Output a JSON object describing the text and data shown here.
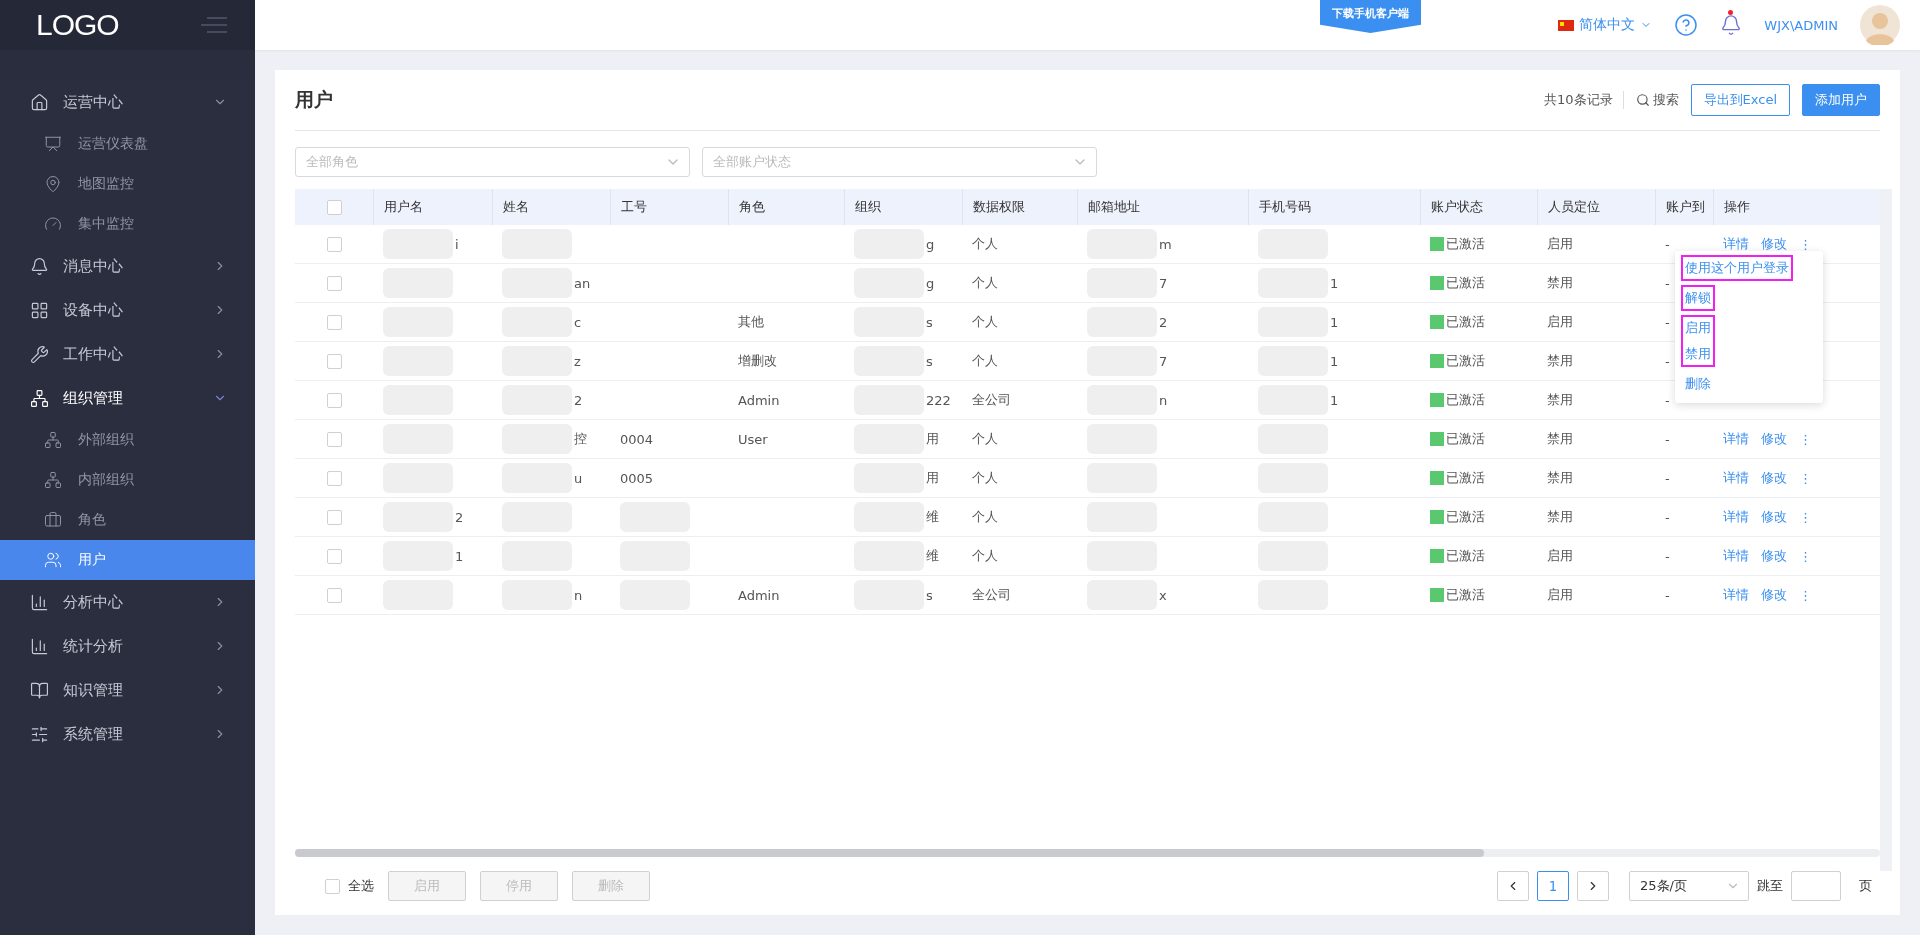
{
  "sidebar": {
    "logo": "LOGO",
    "items": [
      {
        "label": "运营中心",
        "expanded": true,
        "children": [
          {
            "label": "运营仪表盘",
            "selected": false
          },
          {
            "label": "地图监控",
            "selected": false
          },
          {
            "label": "集中监控",
            "selected": false
          }
        ]
      },
      {
        "label": "消息中心",
        "expanded": false
      },
      {
        "label": "设备中心",
        "expanded": false
      },
      {
        "label": "工作中心",
        "expanded": false
      },
      {
        "label": "组织管理",
        "expanded": true,
        "children": [
          {
            "label": "外部组织",
            "selected": false
          },
          {
            "label": "内部组织",
            "selected": false
          },
          {
            "label": "角色",
            "selected": false
          },
          {
            "label": "用户",
            "selected": true
          }
        ]
      },
      {
        "label": "分析中心",
        "expanded": false
      },
      {
        "label": "统计分析",
        "expanded": false
      },
      {
        "label": "知识管理",
        "expanded": false
      },
      {
        "label": "系统管理",
        "expanded": false
      }
    ]
  },
  "header": {
    "download_banner": "下载手机客户端",
    "language": "简体中文",
    "username": "WJX\\ADMIN",
    "has_notification": true
  },
  "page": {
    "title": "用户",
    "record_count": "共10条记录",
    "search": "搜索",
    "export_button": "导出到Excel",
    "add_button": "添加用户",
    "filters": [
      {
        "placeholder": "全部角色"
      },
      {
        "placeholder": "全部账户状态"
      }
    ]
  },
  "table": {
    "columns": [
      "用户名",
      "姓名",
      "工号",
      "角色",
      "组织",
      "数据权限",
      "邮箱地址",
      "手机号码",
      "账户状态",
      "人员定位",
      "账户到",
      "操作"
    ],
    "select_all_checked": false,
    "rows": [
      {
        "checked": false,
        "cells": [
          {
            "text": "i",
            "blurred": true
          },
          {
            "text": "",
            "blurred": true
          },
          {
            "text": ""
          },
          {
            "text": ""
          },
          {
            "text": "g",
            "blurred": true
          },
          {
            "text": "个人"
          },
          {
            "text": "m",
            "blurred": true
          },
          {
            "text": "",
            "blurred": true
          }
        ],
        "status": "已激活",
        "location": "启用",
        "expiry": "-",
        "actions": [
          "详情",
          "修改"
        ],
        "more": "⋮"
      },
      {
        "checked": false,
        "cells": [
          {
            "text": "",
            "blurred": true
          },
          {
            "text": "an",
            "blurred": true
          },
          {
            "text": ""
          },
          {
            "text": ""
          },
          {
            "text": "g",
            "blurred": true
          },
          {
            "text": "个人"
          },
          {
            "text": "7",
            "blurred": true
          },
          {
            "text": "1",
            "blurred": true
          }
        ],
        "status": "已激活",
        "location": "禁用",
        "expiry": "-"
      },
      {
        "checked": false,
        "cells": [
          {
            "text": "",
            "blurred": true
          },
          {
            "text": "c",
            "blurred": true
          },
          {
            "text": ""
          },
          {
            "text": "其他"
          },
          {
            "text": "s",
            "blurred": true
          },
          {
            "text": "个人"
          },
          {
            "text": "2",
            "blurred": true
          },
          {
            "text": "1",
            "blurred": true
          }
        ],
        "status": "已激活",
        "location": "启用",
        "expiry": "-"
      },
      {
        "checked": false,
        "cells": [
          {
            "text": "",
            "blurred": true
          },
          {
            "text": "z",
            "blurred": true
          },
          {
            "text": ""
          },
          {
            "text": "增删改"
          },
          {
            "text": "s",
            "blurred": true
          },
          {
            "text": "个人"
          },
          {
            "text": "7",
            "blurred": true
          },
          {
            "text": "1",
            "blurred": true
          }
        ],
        "status": "已激活",
        "location": "禁用",
        "expiry": "-"
      },
      {
        "checked": false,
        "cells": [
          {
            "text": "",
            "blurred": true
          },
          {
            "text": "2",
            "blurred": true
          },
          {
            "text": ""
          },
          {
            "text": "Admin"
          },
          {
            "text": "222",
            "blurred": true
          },
          {
            "text": "全公司"
          },
          {
            "text": "n",
            "blurred": true
          },
          {
            "text": "1",
            "blurred": true
          }
        ],
        "status": "已激活",
        "location": "禁用",
        "expiry": "-"
      },
      {
        "checked": false,
        "cells": [
          {
            "text": "",
            "blurred": true
          },
          {
            "text": "控",
            "blurred": true
          },
          {
            "text": "0004"
          },
          {
            "text": "User"
          },
          {
            "text": "用",
            "blurred": true
          },
          {
            "text": "个人"
          },
          {
            "text": "",
            "blurred": true
          },
          {
            "text": "",
            "blurred": true
          }
        ],
        "status": "已激活",
        "location": "禁用",
        "expiry": "-",
        "actions": [
          "详情",
          "修改"
        ],
        "more": "⋮"
      },
      {
        "checked": false,
        "cells": [
          {
            "text": "",
            "blurred": true
          },
          {
            "text": "u",
            "blurred": true
          },
          {
            "text": "0005"
          },
          {
            "text": ""
          },
          {
            "text": "用",
            "blurred": true
          },
          {
            "text": "个人"
          },
          {
            "text": "",
            "blurred": true
          },
          {
            "text": "",
            "blurred": true
          }
        ],
        "status": "已激活",
        "location": "禁用",
        "expiry": "-",
        "actions": [
          "详情",
          "修改"
        ],
        "more": "⋮"
      },
      {
        "checked": false,
        "cells": [
          {
            "text": "2",
            "blurred": true
          },
          {
            "text": "",
            "blurred": true
          },
          {
            "text": "",
            "blurred": true
          },
          {
            "text": ""
          },
          {
            "text": "维",
            "blurred": true
          },
          {
            "text": "个人"
          },
          {
            "text": "",
            "blurred": true
          },
          {
            "text": "",
            "blurred": true
          }
        ],
        "status": "已激活",
        "location": "禁用",
        "expiry": "-",
        "actions": [
          "详情",
          "修改"
        ],
        "more": "⋮"
      },
      {
        "checked": false,
        "cells": [
          {
            "text": "1",
            "blurred": true
          },
          {
            "text": "",
            "blurred": true
          },
          {
            "text": "",
            "blurred": true
          },
          {
            "text": ""
          },
          {
            "text": "维",
            "blurred": true
          },
          {
            "text": "个人"
          },
          {
            "text": "",
            "blurred": true
          },
          {
            "text": "",
            "blurred": true
          }
        ],
        "status": "已激活",
        "location": "启用",
        "expiry": "-",
        "actions": [
          "详情",
          "修改"
        ],
        "more": "⋮"
      },
      {
        "checked": false,
        "cells": [
          {
            "text": "",
            "blurred": true
          },
          {
            "text": "n",
            "blurred": true
          },
          {
            "text": "",
            "blurred": true
          },
          {
            "text": "Admin"
          },
          {
            "text": "s",
            "blurred": true
          },
          {
            "text": "全公司"
          },
          {
            "text": "x",
            "blurred": true
          },
          {
            "text": "",
            "blurred": true
          }
        ],
        "status": "已激活",
        "location": "启用",
        "expiry": "-",
        "actions": [
          "详情",
          "修改"
        ],
        "more": "⋮"
      }
    ],
    "menu": [
      {
        "framed": true,
        "items": [
          "使用这个用户登录"
        ]
      },
      {
        "framed": true,
        "items": [
          "解锁"
        ]
      },
      {
        "framed": true,
        "items": [
          "启用",
          "禁用"
        ]
      },
      {
        "framed": false,
        "items": [
          "删除"
        ]
      }
    ]
  },
  "footer": {
    "select_all": "全选",
    "select_all_checked": false,
    "buttons": [
      {
        "label": "启用",
        "disabled": true
      },
      {
        "label": "停用",
        "disabled": true
      },
      {
        "label": "删除",
        "disabled": true
      }
    ],
    "pages": [
      {
        "label": "1",
        "selected": true
      }
    ],
    "page_size": "25条/页",
    "jump_label": "跳至",
    "page_unit": "页"
  }
}
